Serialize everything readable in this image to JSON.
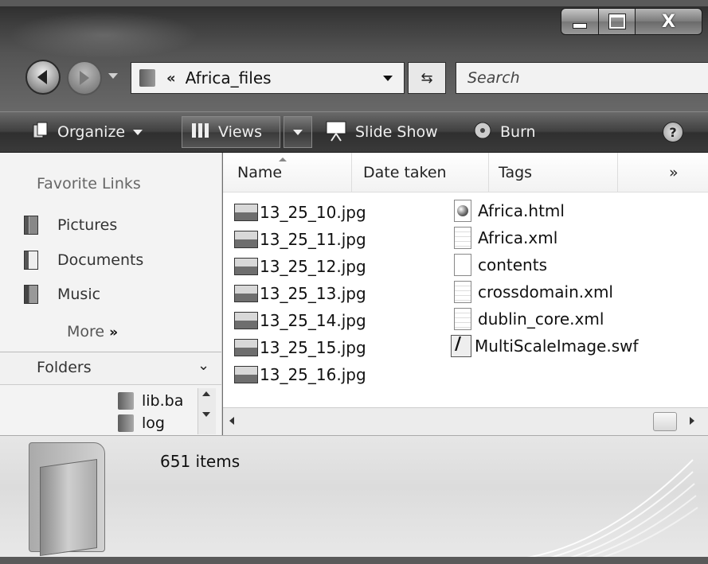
{
  "window": {
    "controls": {
      "minimize": "minimize-icon",
      "maximize": "maximize-icon",
      "close": "X"
    }
  },
  "nav": {
    "address_chevron": "«",
    "address": "Africa_files",
    "search_placeholder": "Search",
    "refresh_glyph": "⇆"
  },
  "toolbar": {
    "organize": "Organize",
    "views": "Views",
    "slideshow": "Slide Show",
    "burn": "Burn",
    "help": "?"
  },
  "navpane": {
    "favorite_links": "Favorite Links",
    "links": [
      {
        "label": "Pictures",
        "icon": "pictures-icon"
      },
      {
        "label": "Documents",
        "icon": "documents-icon"
      },
      {
        "label": "Music",
        "icon": "music-icon"
      }
    ],
    "more": "More",
    "more_glyph": "»",
    "folders": "Folders",
    "folders_chevron": "⌄",
    "tree": [
      "lib.ba",
      "log"
    ]
  },
  "columns": {
    "name": "Name",
    "date_taken": "Date taken",
    "tags": "Tags",
    "overflow": "»"
  },
  "files_left": [
    "13_25_10.jpg",
    "13_25_11.jpg",
    "13_25_12.jpg",
    "13_25_13.jpg",
    "13_25_14.jpg",
    "13_25_15.jpg",
    "13_25_16.jpg"
  ],
  "files_right": [
    {
      "name": "Africa.html",
      "icon": "html-file-icon"
    },
    {
      "name": "Africa.xml",
      "icon": "xml-file-icon"
    },
    {
      "name": "contents",
      "icon": "blank-file-icon"
    },
    {
      "name": "crossdomain.xml",
      "icon": "xml-file-icon"
    },
    {
      "name": "dublin_core.xml",
      "icon": "xml-file-icon"
    },
    {
      "name": "MultiScaleImage.swf",
      "icon": "swf-file-icon"
    }
  ],
  "details": {
    "count": "651 items"
  }
}
